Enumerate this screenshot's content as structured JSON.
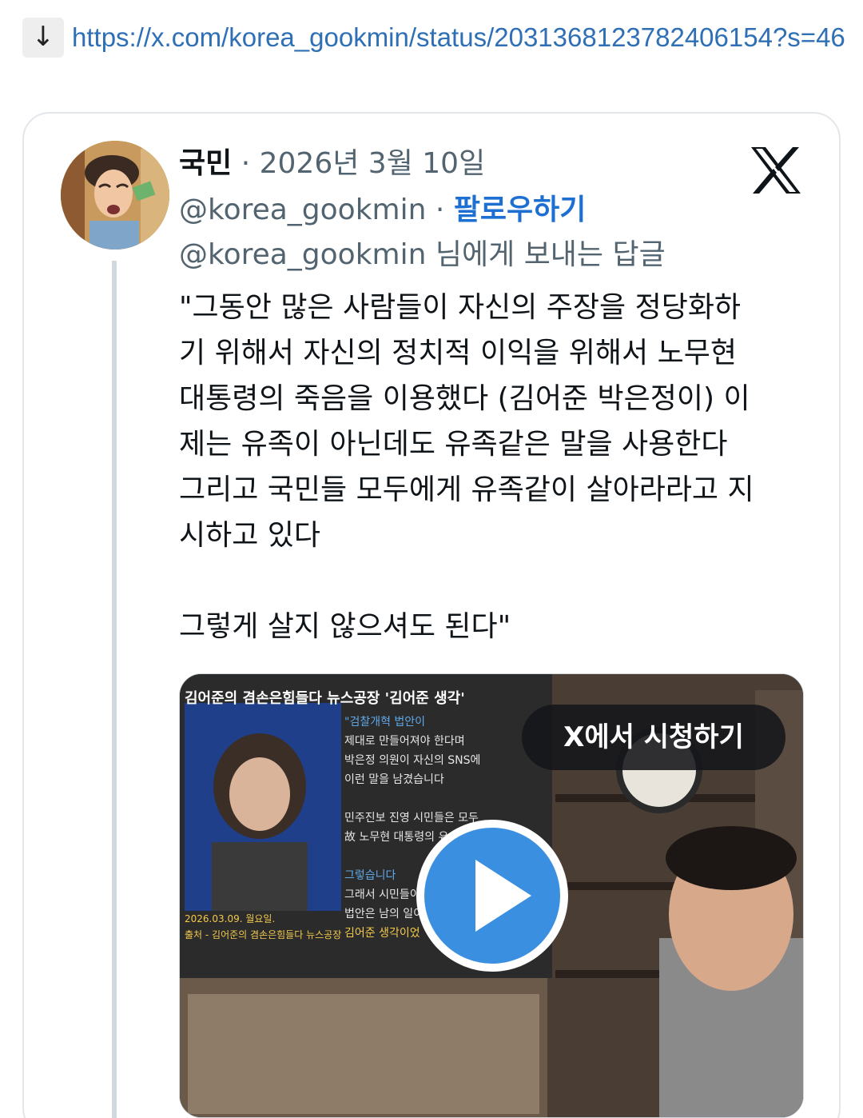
{
  "link": {
    "download_icon": "↓",
    "url": "https://x.com/korea_gookmin/status/2031368123782406154?s=46"
  },
  "tweet": {
    "author_name": "국민",
    "separator": "·",
    "date": "2026년 3월 10일",
    "handle": "@korea_gookmin",
    "follow_label": "팔로우하기",
    "reply_to": "@korea_gookmin 님에게 보내는 답글",
    "body": "\"그동안 많은 사람들이 자신의 주장을 정당화하\n기 위해서 자신의 정치적 이익을 위해서 노무현\n대통령의 죽음을 이용했다 (김어준 박은정이) 이\n제는 유족이 아닌데도 유족같은 말을 사용한다\n그리고 국민들 모두에게 유족같이 살아라라고 지\n시하고 있다\n\n그렇게 살지 않으셔도 된다\"",
    "logo_icon": "x-logo-icon"
  },
  "video": {
    "watch_label": "X에서 시청하기",
    "thumbnail": {
      "header": "김어준의 겸손은힘들다 뉴스공장 '김어준 생각'",
      "lines": [
        "\"검찰개혁 법안이",
        "제대로 만들어져야 한다며",
        "박은정 의원이 자신의 SNS에",
        "이런 말을 남겼습니다",
        "민주진보 진영 시민들은 모두",
        "故 노무현 대통령의 유",
        "그렇습니다",
        "그래서 시민들이",
        "법안은 남의 일이",
        "김어준 생각이었"
      ],
      "date_caption": "2026.03.09. 월요일.",
      "source_caption": "출처 - 김어준의 겸손은힘들다 뉴스공장"
    },
    "accent_blue": "#3b8fe0",
    "accent_yellow": "#f2c94c"
  }
}
